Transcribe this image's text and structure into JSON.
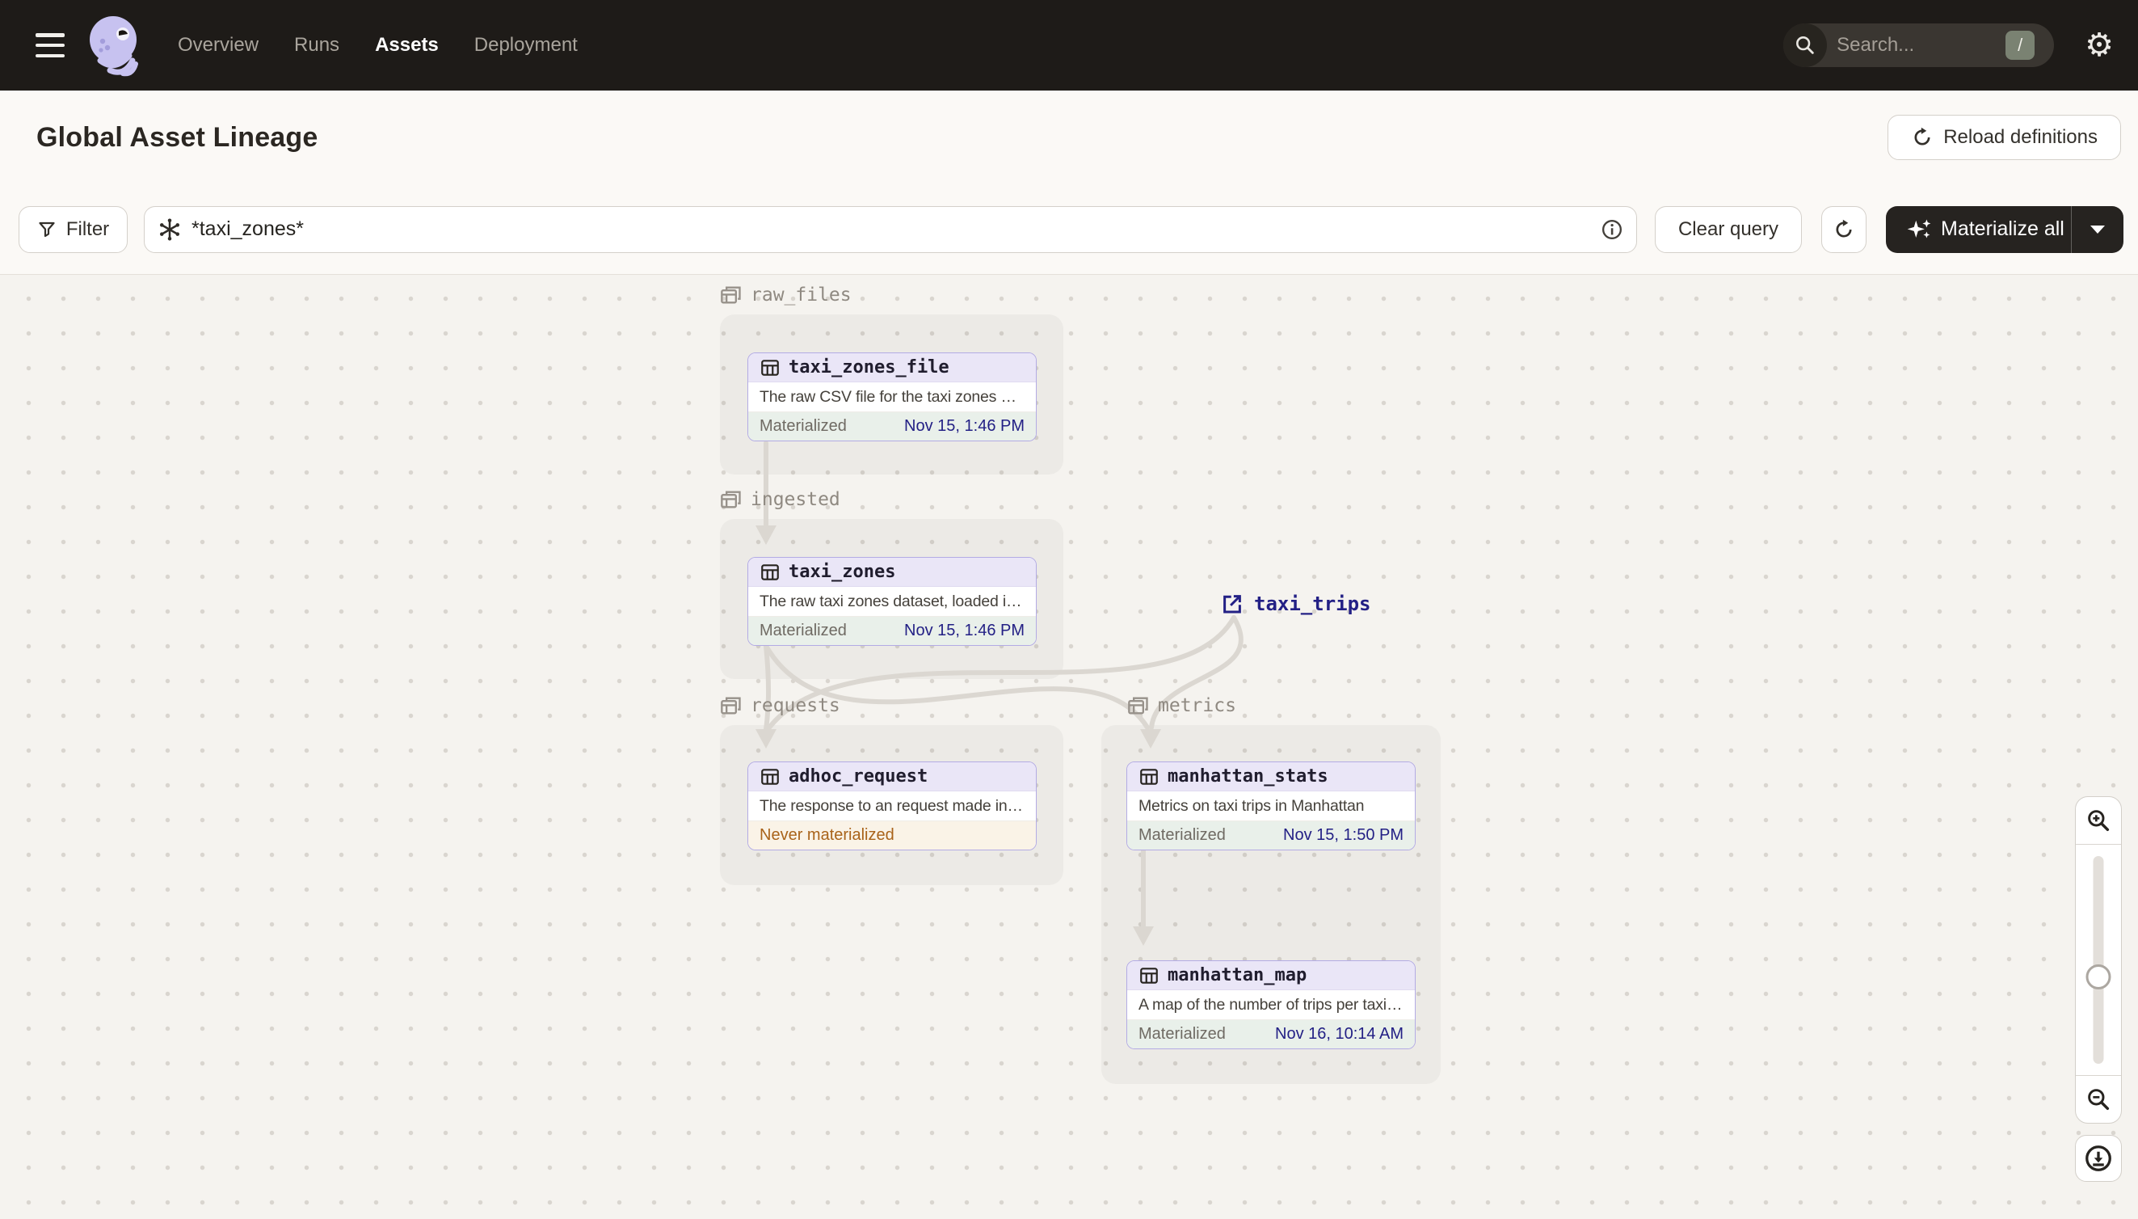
{
  "nav": {
    "menu_items": [
      {
        "label": "Overview",
        "active": false
      },
      {
        "label": "Runs",
        "active": false
      },
      {
        "label": "Assets",
        "active": true
      },
      {
        "label": "Deployment",
        "active": false
      }
    ],
    "search": {
      "placeholder": "Search...",
      "shortcut_key": "/"
    }
  },
  "header": {
    "title": "Global Asset Lineage",
    "reload_button": "Reload definitions"
  },
  "toolbar": {
    "filter_button": "Filter",
    "query_value": "*taxi_zones*",
    "clear_button": "Clear query",
    "materialize_button": "Materialize all"
  },
  "graph": {
    "groups": [
      {
        "name": "raw_files"
      },
      {
        "name": "ingested"
      },
      {
        "name": "requests"
      },
      {
        "name": "metrics"
      }
    ],
    "nodes": [
      {
        "name": "taxi_zones_file",
        "description": "The raw CSV file for the taxi zones dat...",
        "status": "Materialized",
        "timestamp": "Nov 15, 1:46 PM"
      },
      {
        "name": "taxi_zones",
        "description": "The raw taxi zones dataset, loaded int...",
        "status": "Materialized",
        "timestamp": "Nov 15, 1:46 PM"
      },
      {
        "name": "adhoc_request",
        "description": "The response to an request made in th...",
        "status": "Never materialized",
        "timestamp": ""
      },
      {
        "name": "manhattan_stats",
        "description": "Metrics on taxi trips in Manhattan",
        "status": "Materialized",
        "timestamp": "Nov 15, 1:50 PM"
      },
      {
        "name": "manhattan_map",
        "description": "A map of the number of trips per taxi z...",
        "status": "Materialized",
        "timestamp": "Nov 16, 10:14 AM"
      }
    ],
    "external_asset": {
      "name": "taxi_trips"
    }
  },
  "colors": {
    "nav_bg": "#1E1B18",
    "accent_purple": "#B3ABE4",
    "node_header_bg": "#EAE6F7",
    "materialized_bg": "#E9F0EA",
    "materialized_date_text": "#232085",
    "never_materialized_bg": "#FAF3E7",
    "never_materialized_text": "#A9631A",
    "edge": "#DBD7D1"
  }
}
